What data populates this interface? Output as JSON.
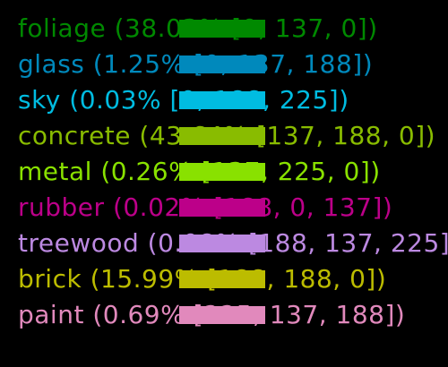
{
  "legend": {
    "items": [
      {
        "text": "foliage (38.03% [0, 137, 0])",
        "color": "#008900"
      },
      {
        "text": "glass (1.25% [0, 137, 188])",
        "color": "#0089BC"
      },
      {
        "text": "sky (0.03% [0, 188, 225])",
        "color": "#00BCE1"
      },
      {
        "text": "concrete (43.64% [137, 188, 0])",
        "color": "#89BC00"
      },
      {
        "text": "metal (0.26% [137, 225, 0])",
        "color": "#89E100"
      },
      {
        "text": "rubber (0.02% [188, 0, 137])",
        "color": "#BC0089"
      },
      {
        "text": "treewood (0.08% [188, 137, 225])",
        "color": "#BC89E1"
      },
      {
        "text": "brick (15.99% [188, 188, 0])",
        "color": "#BCBC00"
      },
      {
        "text": "paint (0.69% [225, 137, 188])",
        "color": "#E189BC"
      }
    ]
  }
}
